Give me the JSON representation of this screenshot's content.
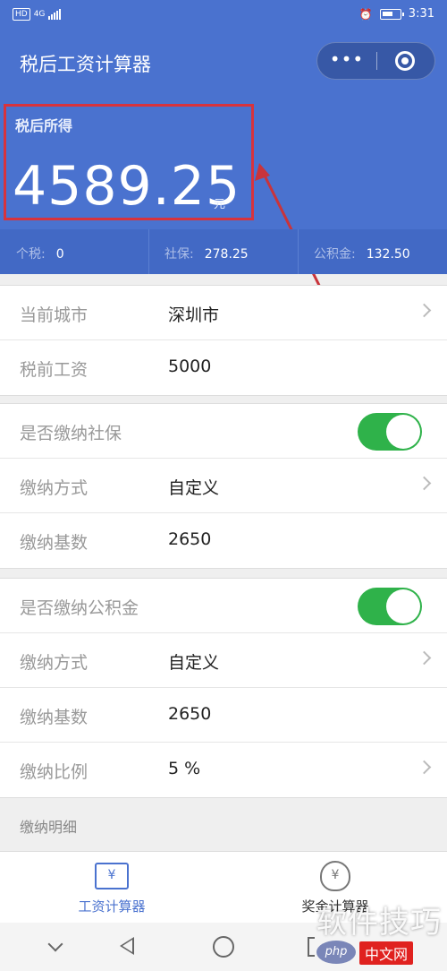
{
  "status_bar": {
    "network": "HD",
    "signal_label": "4G",
    "time": "3:31"
  },
  "app": {
    "title": "税后工资计算器",
    "more_label": "•••"
  },
  "result": {
    "label": "税后所得",
    "value": "4589.25",
    "unit": "元"
  },
  "summary": [
    {
      "label": "个税:",
      "value": "0"
    },
    {
      "label": "社保:",
      "value": "278.25"
    },
    {
      "label": "公积金:",
      "value": "132.50"
    }
  ],
  "basic": {
    "city_label": "当前城市",
    "city_value": "深圳市",
    "salary_label": "税前工资",
    "salary_value": "5000"
  },
  "social": {
    "toggle_label": "是否缴纳社保",
    "enabled": true,
    "method_label": "缴纳方式",
    "method_value": "自定义",
    "base_label": "缴纳基数",
    "base_value": "2650"
  },
  "fund": {
    "toggle_label": "是否缴纳公积金",
    "enabled": true,
    "method_label": "缴纳方式",
    "method_value": "自定义",
    "base_label": "缴纳基数",
    "base_value": "2650",
    "ratio_label": "缴纳比例",
    "ratio_value": "5 %"
  },
  "detail_label": "缴纳明细",
  "tabs": [
    {
      "label": "工资计算器",
      "icon": "salary-calculator-icon",
      "active": true
    },
    {
      "label": "奖金计算器",
      "icon": "money-bag-icon",
      "active": false
    }
  ],
  "watermark": {
    "text": "软件技巧",
    "badge_php": "php",
    "badge_cn": "中文网"
  },
  "colors": {
    "primary": "#4a72cf",
    "toggle_on": "#2fb24a",
    "highlight": "#d8333d"
  }
}
